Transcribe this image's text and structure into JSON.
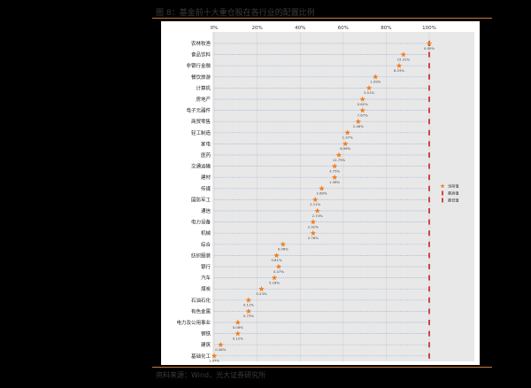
{
  "figure_title": "图 8：基金前十大重仓股在各行业的配置比例",
  "source_note": "资料来源：Wind，光大证券研究所",
  "colors": {
    "page_background": "#000000",
    "plot_background": "#e8e8e8",
    "mark": "#f07d1e",
    "industry_bar": "#c81e1e",
    "grid": "#a8b8d8",
    "rule": "#c87a3a"
  },
  "chart_data": {
    "type": "scatter",
    "orientation": "horizontal",
    "title": "",
    "xlabel": "",
    "ylabel": "",
    "x_axis_ticks": [
      "0%",
      "20%",
      "40%",
      "60%",
      "80%",
      "100%"
    ],
    "xlim": [
      0,
      100
    ],
    "grid": true,
    "legend_position": "right",
    "legend": [
      {
        "label": "当前值",
        "marker": "star"
      },
      {
        "label": "最高值",
        "marker": "bar"
      },
      {
        "label": "最低值",
        "marker": "bar"
      }
    ],
    "categories": [
      "农林牧渔",
      "食品饮料",
      "非银行金融",
      "餐饮旅游",
      "计算机",
      "房地产",
      "电子元器件",
      "商贸零售",
      "轻工制造",
      "家电",
      "医药",
      "交通运输",
      "建材",
      "传媒",
      "国防军工",
      "通信",
      "电力设备",
      "机械",
      "综合",
      "纺织服装",
      "银行",
      "汽车",
      "煤炭",
      "石油石化",
      "有色金属",
      "电力及公用事业",
      "钢铁",
      "建筑",
      "基础化工"
    ],
    "series": [
      {
        "name": "当前值",
        "values": [
          100,
          88,
          86,
          75,
          72,
          69,
          69,
          67,
          62,
          61,
          58,
          56,
          56,
          50,
          47,
          48,
          46,
          46,
          32,
          29,
          30,
          28,
          22,
          16,
          16,
          11,
          11,
          3,
          0
        ]
      },
      {
        "name": "最高值",
        "values": [
          100,
          100,
          100,
          100,
          100,
          100,
          100,
          100,
          100,
          100,
          100,
          100,
          100,
          100,
          100,
          100,
          100,
          100,
          100,
          100,
          100,
          100,
          100,
          100,
          100,
          100,
          100,
          100,
          100
        ]
      }
    ],
    "point_labels": [
      "0.00%",
      "15.31%",
      "8.33%",
      "1.09%",
      "3.51%",
      "0.62%",
      "7.67%",
      "2.46%",
      "1.37%",
      "6.96%",
      "12.75%",
      "3.75%",
      "1.36%",
      "2.69%",
      "2.11%",
      "2.74%",
      "2.92%",
      "2.76%",
      "0.06%",
      "0.61%",
      "0.47%",
      "5.18%",
      "0.23%",
      "0.11%",
      "0.73%",
      "0.08%",
      "0.12%",
      "0.48%",
      "1.07%"
    ]
  }
}
